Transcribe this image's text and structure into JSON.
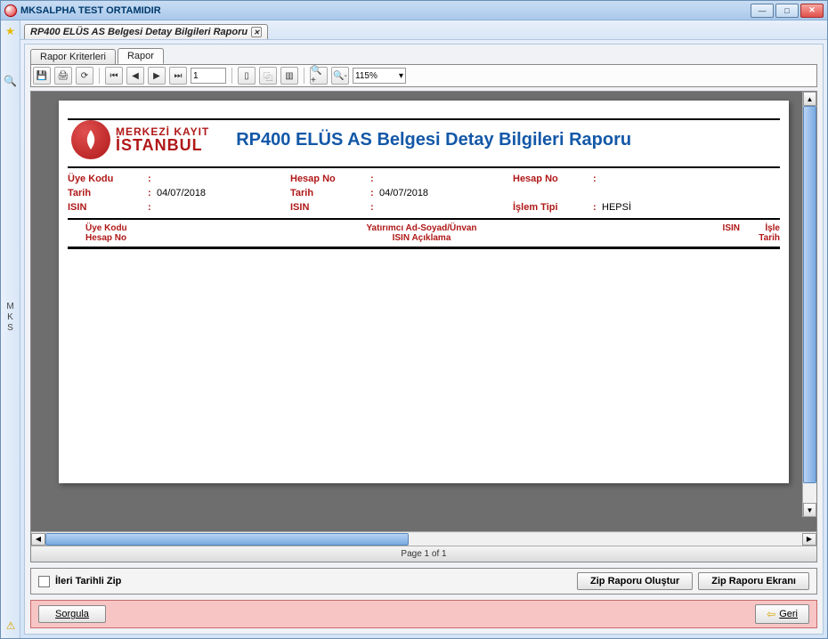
{
  "window": {
    "title": "MKSALPHA TEST ORTAMIDIR"
  },
  "doc_tab": "RP400 ELÜS AS Belgesi Detay Bilgileri Raporu",
  "sidebar": {
    "mks": "M\nK\nS"
  },
  "inner_tabs": {
    "criteria": "Rapor Kriterleri",
    "report": "Rapor"
  },
  "toolbar": {
    "page_value": "1",
    "zoom_value": "115%"
  },
  "report": {
    "logo_line1": "MERKEZİ KAYIT",
    "logo_line2": "İSTANBUL",
    "title": "RP400 ELÜS AS Belgesi Detay Bilgileri Raporu",
    "criteria": {
      "uye_kodu_lbl": "Üye Kodu",
      "uye_kodu_val": "",
      "hesap_no_lbl1": "Hesap No",
      "hesap_no_val1": "",
      "hesap_no_lbl2": "Hesap No",
      "hesap_no_val2": "",
      "tarih_lbl1": "Tarih",
      "tarih_val1": "04/07/2018",
      "tarih_lbl2": "Tarih",
      "tarih_val2": "04/07/2018",
      "isin_lbl1": "ISIN",
      "isin_val1": "",
      "isin_lbl2": "ISIN",
      "isin_val2": "",
      "islem_tipi_lbl": "İşlem Tipi",
      "islem_tipi_val": "HEPSİ"
    },
    "columns": {
      "uye_kodu": "Üye Kodu",
      "yatirimci": "Yatırımcı Ad-Soyad/Ünvan",
      "isin": "ISIN",
      "islem": "İşle",
      "hesap_no": "Hesap No",
      "isin_aciklama": "ISIN Açıklama",
      "tarih": "Tarih"
    },
    "page_indicator": "Page 1 of 1"
  },
  "zip": {
    "ileri_tarihli": "İleri Tarihli Zip",
    "olustur": "Zip Raporu Oluştur",
    "ekrani": "Zip Raporu Ekranı"
  },
  "bottom": {
    "sorgula": "Sorgula",
    "geri": "Geri"
  }
}
